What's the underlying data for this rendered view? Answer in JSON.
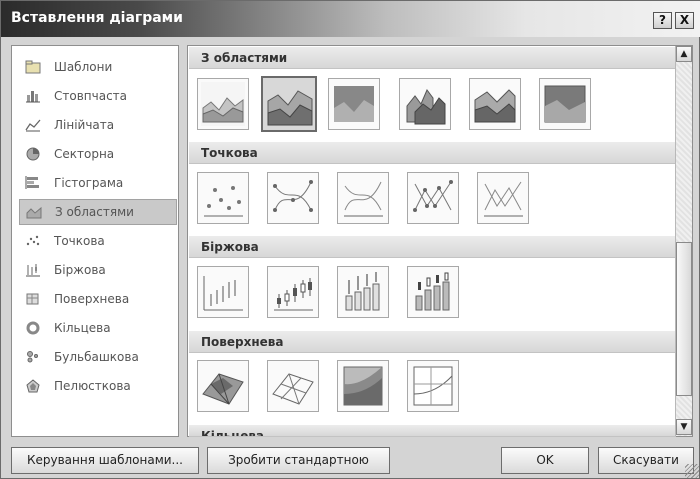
{
  "window": {
    "title": "Вставлення діаграми",
    "help_label": "?",
    "close_label": "X"
  },
  "categories": [
    {
      "label": "Шаблони",
      "icon": "folder-icon"
    },
    {
      "label": "Стовпчаста",
      "icon": "column-chart-icon"
    },
    {
      "label": "Лінійчата",
      "icon": "line-chart-icon"
    },
    {
      "label": "Секторна",
      "icon": "pie-chart-icon"
    },
    {
      "label": "Гістограма",
      "icon": "bar-chart-icon"
    },
    {
      "label": "З областями",
      "icon": "area-chart-icon",
      "selected": true
    },
    {
      "label": "Точкова",
      "icon": "scatter-chart-icon"
    },
    {
      "label": "Біржова",
      "icon": "stock-chart-icon"
    },
    {
      "label": "Поверхнева",
      "icon": "surface-chart-icon"
    },
    {
      "label": "Кільцева",
      "icon": "doughnut-chart-icon"
    },
    {
      "label": "Бульбашкова",
      "icon": "bubble-chart-icon"
    },
    {
      "label": "Пелюсткова",
      "icon": "radar-chart-icon"
    }
  ],
  "sections": [
    {
      "title": "З областями"
    },
    {
      "title": "Точкова"
    },
    {
      "title": "Біржова"
    },
    {
      "title": "Поверхнева"
    },
    {
      "title": "Кільцева"
    }
  ],
  "buttons": {
    "manage_templates": "Керування шаблонами...",
    "set_default": "Зробити стандартною",
    "ok": "OK",
    "cancel": "Скасувати"
  },
  "scrollbar": {
    "up_icon": "arrow-up-icon",
    "down_icon": "arrow-down-icon"
  }
}
